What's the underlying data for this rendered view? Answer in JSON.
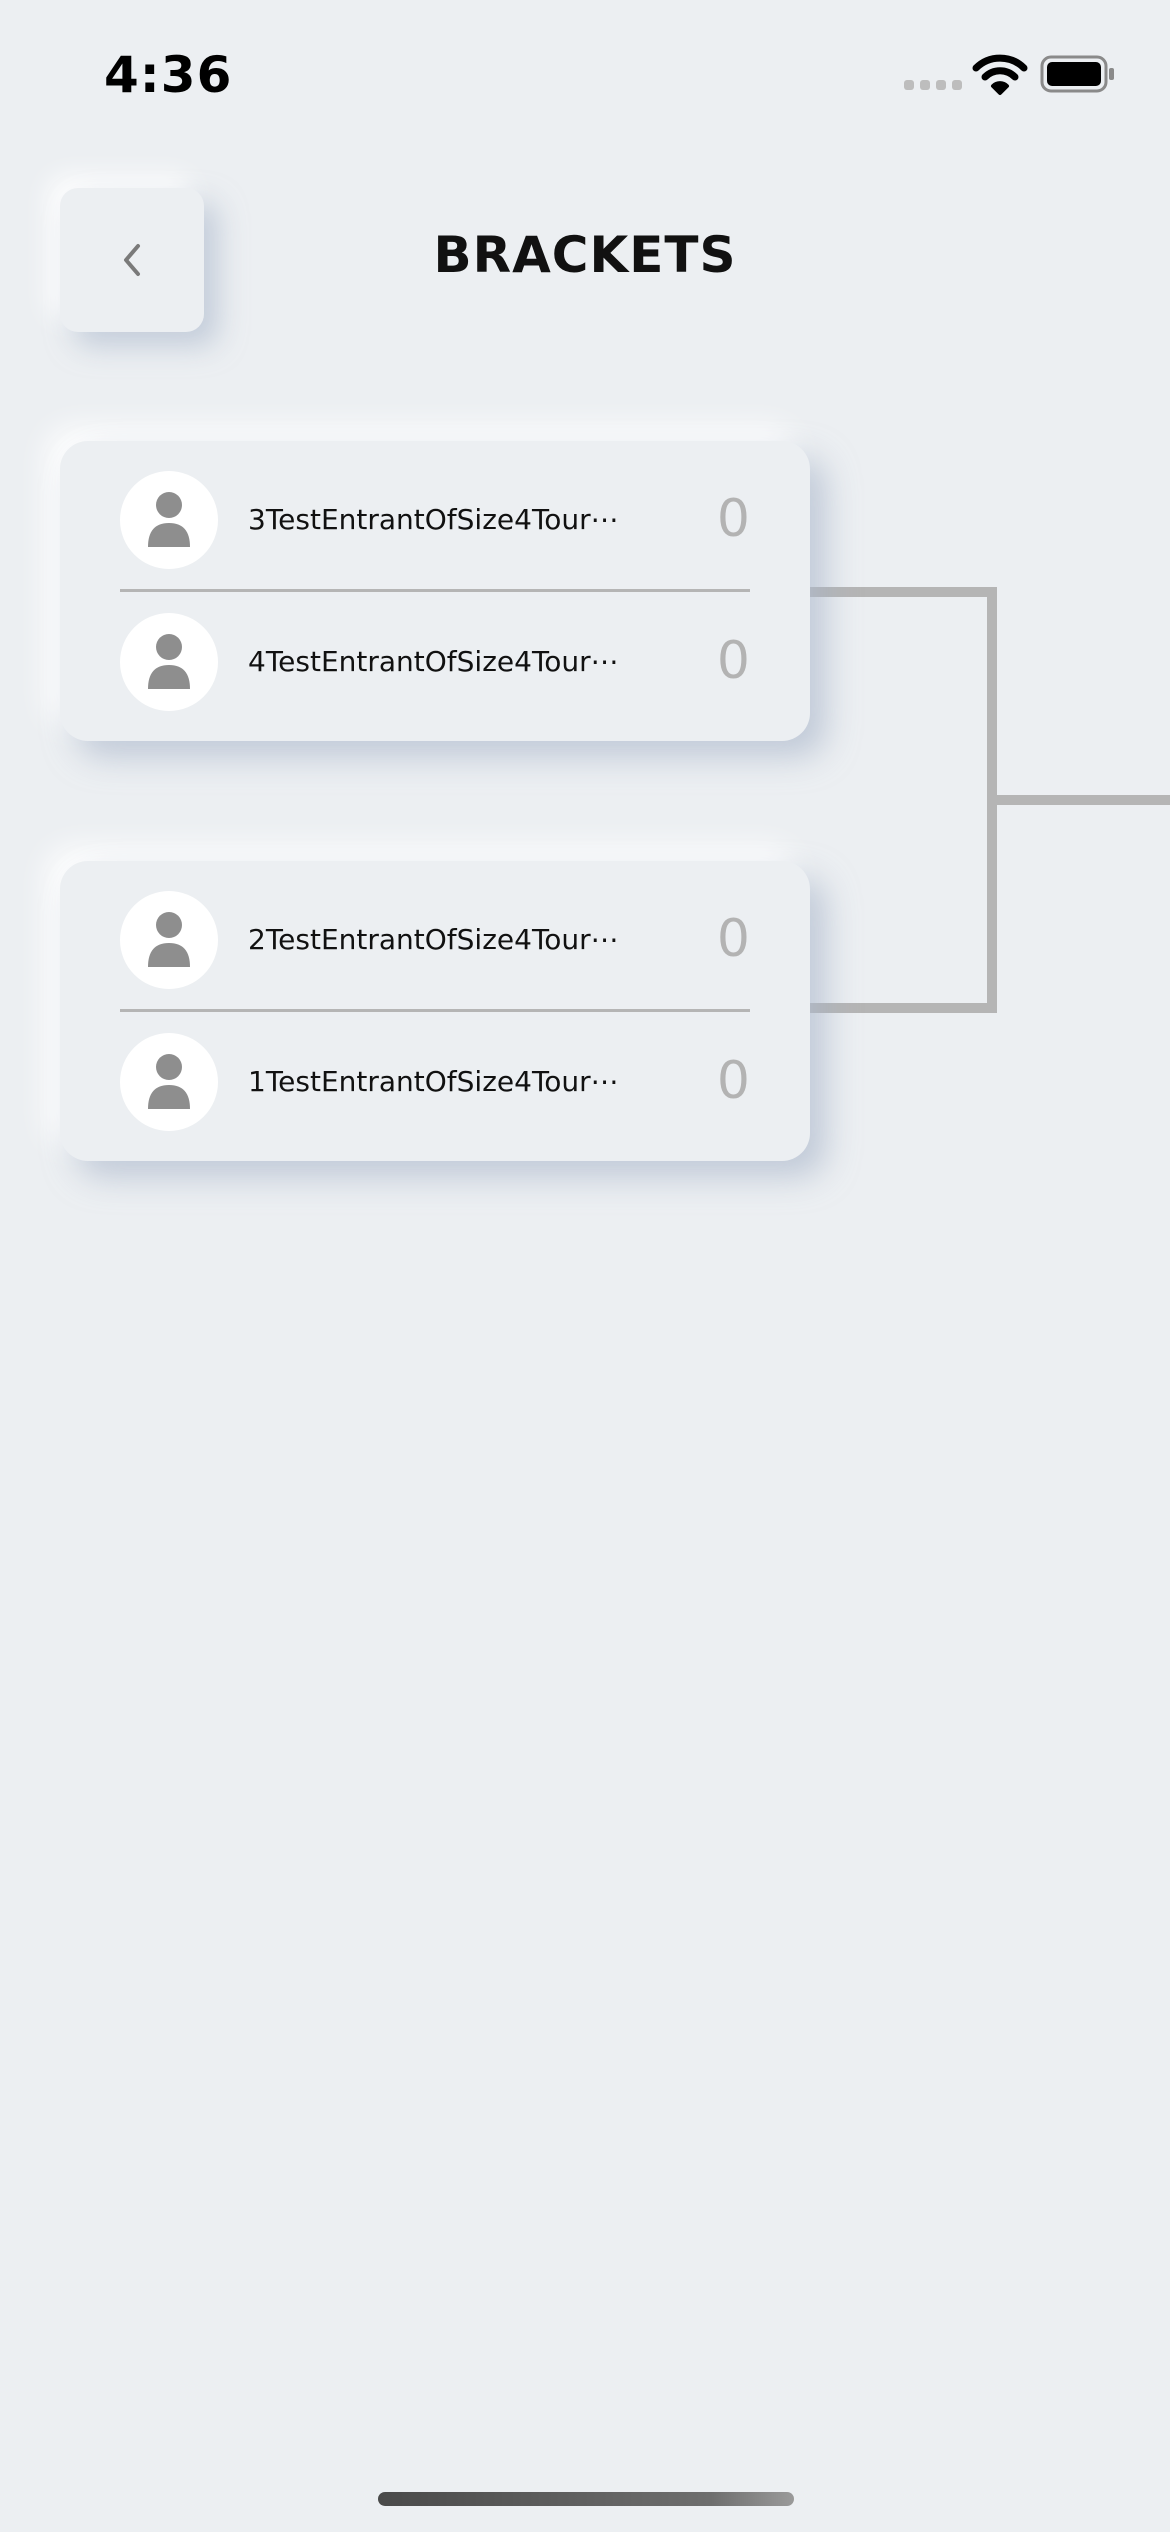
{
  "status_bar": {
    "time": "4:36",
    "icons": [
      "cellular-signal-icon",
      "wifi-icon",
      "battery-icon"
    ]
  },
  "header": {
    "back_icon": "chevron-left-icon",
    "title": "BRACKETS"
  },
  "matches": [
    {
      "entrants": [
        {
          "name": "3TestEntrantOfSize4Tour⋯",
          "score": "0",
          "avatar_icon": "person-icon"
        },
        {
          "name": "4TestEntrantOfSize4Tour⋯",
          "score": "0",
          "avatar_icon": "person-icon"
        }
      ]
    },
    {
      "entrants": [
        {
          "name": "2TestEntrantOfSize4Tour⋯",
          "score": "0",
          "avatar_icon": "person-icon"
        },
        {
          "name": "1TestEntrantOfSize4Tour⋯",
          "score": "0",
          "avatar_icon": "person-icon"
        }
      ]
    }
  ],
  "colors": {
    "background": "#ECEFF2",
    "score": "#B3B3B3",
    "connector": "#B5B5B5",
    "avatar_figure": "#8E8E8E"
  }
}
